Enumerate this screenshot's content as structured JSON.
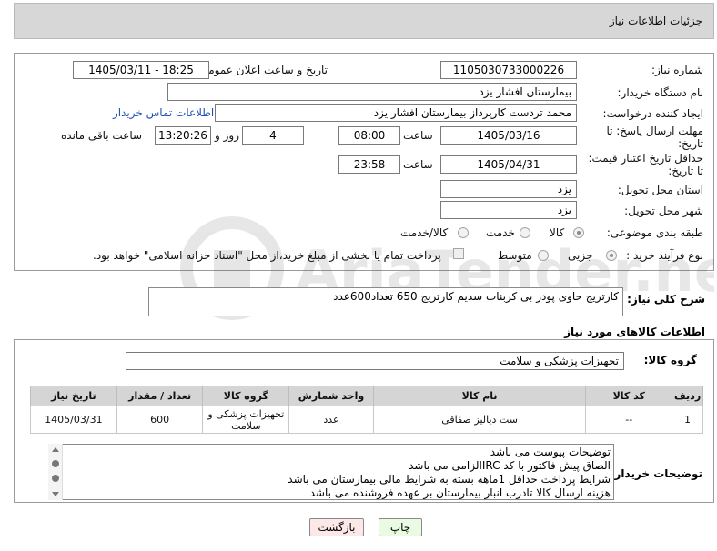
{
  "header": {
    "title": "جزئیات اطلاعات نیاز"
  },
  "form": {
    "need_number_label": "شماره نیاز:",
    "need_number": "1105030733000226",
    "announce_label": "تاریخ و ساعت اعلان عمومی:",
    "announce_value": "1405/03/11 - 18:25",
    "buyer_org_label": "نام دستگاه خریدار:",
    "buyer_org": "بیمارستان افشار یزد",
    "creator_label": "ایجاد کننده درخواست:",
    "creator": "محمد تردست کارپرداز بیمارستان افشار یزد",
    "contact_link": "اطلاعات تماس خریدار",
    "deadline_label_1": "مهلت ارسال پاسخ: تا",
    "deadline_label_2": "تاریخ:",
    "deadline_date": "1405/03/16",
    "time_label": "ساعت",
    "deadline_time": "08:00",
    "days": "4",
    "days_label": "روز و",
    "remaining": "13:20:26",
    "remaining_label": "ساعت باقی مانده",
    "price_label_1": "حداقل تاریخ اعتبار قیمت:",
    "price_label_2": "تا تاریخ:",
    "price_date": "1405/04/31",
    "price_time": "23:58",
    "province_label": "استان محل تحویل:",
    "province": "یزد",
    "city_label": "شهر محل تحویل:",
    "city": "یزد",
    "category_label": "طبقه بندی موضوعی:",
    "category_options": [
      "کالا",
      "خدمت",
      "کالا/خدمت"
    ],
    "process_label": "نوع فرآیند خرید :",
    "process_options": [
      "جزیی",
      "متوسط"
    ],
    "payment_note": "پرداخت تمام یا بخشی از مبلغ خرید،از محل \"اسناد خزانه اسلامی\" خواهد بود."
  },
  "summary": {
    "label": "شرح کلی نیاز:",
    "text": "کارتریج حاوی پودر بی کربنات سدیم  کارتریج 650 تعداد600عدد"
  },
  "goods": {
    "section_title": "اطلاعات کالاهای مورد نیاز",
    "group_label": "گروه کالا:",
    "group_value": "تجهیزات پزشکی و سلامت",
    "columns": [
      "ردیف",
      "کد کالا",
      "نام کالا",
      "واحد شمارش",
      "گروه کالا",
      "تعداد / مقدار",
      "تاریخ نیاز"
    ],
    "rows": [
      [
        "1",
        "--",
        "ست دیالیز صفاقی",
        "عدد",
        "تجهیزات پزشکی و سلامت",
        "600",
        "1405/03/31"
      ]
    ]
  },
  "buyer_notes": {
    "label": "توضیحات خریدار:",
    "lines": [
      "توضیحات پیوست می باشد",
      "الصاق پیش فاکتور با کد  IRCالزامی می باشد",
      "شرایط پرداخت حداقل 1ماهه بسته به شرایط مالی بیمارستان می باشد",
      "هزینه ارسال کالا تادرب انبار بیمارستان بر عهده فروشنده می باشد"
    ]
  },
  "buttons": {
    "print": "چاپ",
    "back": "بازگشت"
  },
  "watermark": {
    "text": "AriaTender.net"
  },
  "colors": {
    "link": "#1e4fb4",
    "print_bg": "#e9fbe3",
    "back_bg": "#fde8e8",
    "header_bg": "#d7d7d7"
  }
}
